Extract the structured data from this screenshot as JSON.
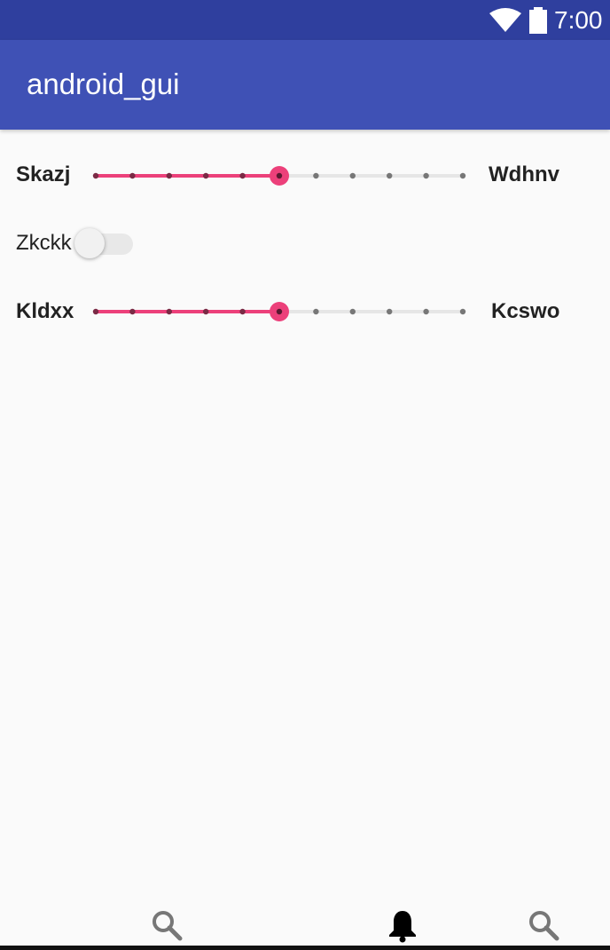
{
  "status_bar": {
    "time": "7:00",
    "icons": [
      "wifi-icon",
      "battery-icon"
    ]
  },
  "app_bar": {
    "title": "android_gui"
  },
  "sliders": [
    {
      "left_label": "Skazj",
      "right_label": "Wdhnv",
      "value": 5,
      "max": 10
    },
    {
      "left_label": "Kldxx",
      "right_label": "Kcswo",
      "value": 5,
      "max": 10
    }
  ],
  "switch": {
    "label": "Zkckk",
    "checked": false
  },
  "bottom_nav": {
    "items": [
      "search-icon",
      "bell-icon",
      "search-icon"
    ]
  },
  "colors": {
    "primary": "#3f51b5",
    "primary_dark": "#2f3f9e",
    "accent": "#ec407a"
  }
}
